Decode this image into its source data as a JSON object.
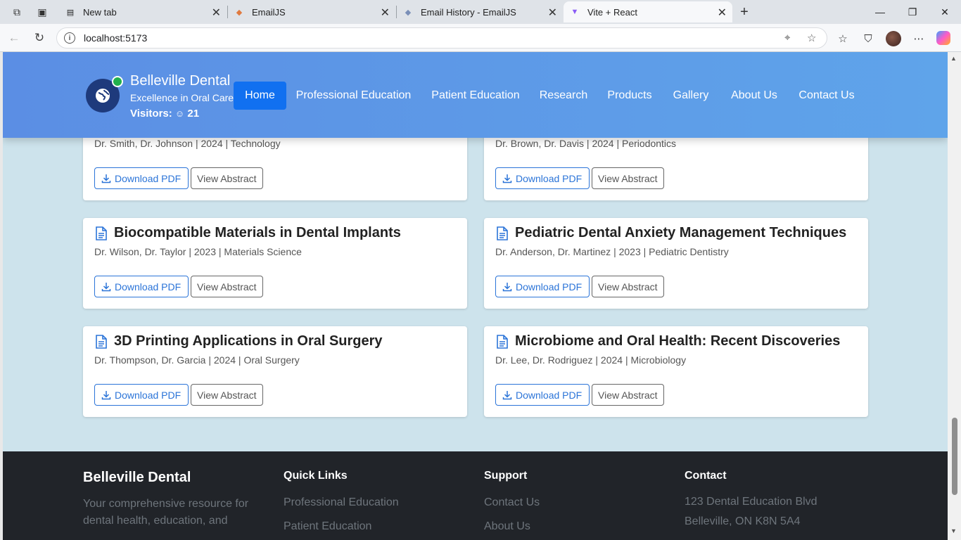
{
  "browser": {
    "tabs": [
      {
        "title": "New tab",
        "favicon": "newtab-icon"
      },
      {
        "title": "EmailJS",
        "favicon": "emailjs-icon"
      },
      {
        "title": "Email History - EmailJS",
        "favicon": "emailjs-icon"
      },
      {
        "title": "Vite + React",
        "favicon": "vite-icon"
      }
    ],
    "url": "localhost:5173"
  },
  "header": {
    "brand_name": "Belleville Dental",
    "tagline": "Excellence in Oral Care",
    "visitors_label": "Visitors:",
    "visitors_count": "21",
    "nav": [
      {
        "label": "Home",
        "active": true
      },
      {
        "label": "Professional Education",
        "active": false
      },
      {
        "label": "Patient Education",
        "active": false
      },
      {
        "label": "Research",
        "active": false
      },
      {
        "label": "Products",
        "active": false
      },
      {
        "label": "Gallery",
        "active": false
      },
      {
        "label": "About Us",
        "active": false
      },
      {
        "label": "Contact Us",
        "active": false
      }
    ]
  },
  "papers": [
    {
      "title": "",
      "meta": "Dr. Smith, Dr. Johnson | 2024 | Technology"
    },
    {
      "title": "",
      "meta": "Dr. Brown, Dr. Davis | 2024 | Periodontics"
    },
    {
      "title": "Biocompatible Materials in Dental Implants",
      "meta": "Dr. Wilson, Dr. Taylor | 2023 | Materials Science"
    },
    {
      "title": "Pediatric Dental Anxiety Management Techniques",
      "meta": "Dr. Anderson, Dr. Martinez | 2023 | Pediatric Dentistry"
    },
    {
      "title": "3D Printing Applications in Oral Surgery",
      "meta": "Dr. Thompson, Dr. Garcia | 2024 | Oral Surgery"
    },
    {
      "title": "Microbiome and Oral Health: Recent Discoveries",
      "meta": "Dr. Lee, Dr. Rodriguez | 2024 | Microbiology"
    }
  ],
  "buttons": {
    "download": "Download PDF",
    "abstract": "View Abstract"
  },
  "footer": {
    "brand": "Belleville Dental",
    "description": [
      "Your comprehensive resource for",
      "dental health, education, and"
    ],
    "quick_links_title": "Quick Links",
    "quick_links": [
      "Professional Education",
      "Patient Education"
    ],
    "support_title": "Support",
    "support_links": [
      "Contact Us",
      "About Us"
    ],
    "contact_title": "Contact",
    "contact_lines": [
      "123 Dental Education Blvd",
      "Belleville, ON K8N 5A4"
    ]
  },
  "colors": {
    "header_start": "#5b8ee4",
    "header_end": "#5fa4ea",
    "nav_active": "#1170f0",
    "page_bg": "#cde3ec",
    "footer_bg": "#212429",
    "link_blue": "#2b74d8"
  }
}
